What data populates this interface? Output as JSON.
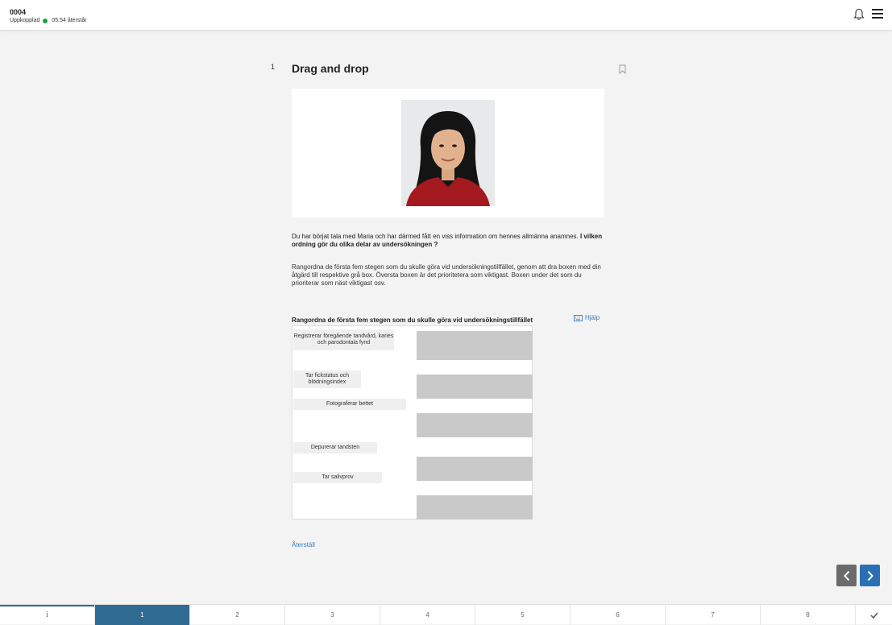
{
  "header": {
    "candidate_id": "0004",
    "connection_status": "Uppkopplad",
    "time_remaining": "05:54 återstår",
    "status_color": "#1aa34a",
    "icons": {
      "notifications": "bell-icon",
      "menu": "hamburger-menu-icon"
    }
  },
  "question": {
    "number": "1",
    "title": "Drag and drop",
    "bookmark_icon": "bookmark-icon",
    "image_subject": "portrait",
    "intro_text": "Du har börjat tala med Maria och har därmed fått en viss information om hennes allmänna anamnes.",
    "intro_bold": "I vilken ordning gör du olika delar av undersökningen ?",
    "instructions": "Rangordna de första fem stegen som du skulle göra vid undersökningstillfället, genom att dra boxen med din åtgärd till respektive grå box. Översta boxen är det prioritetera som viktigast. Boxen under det som du prioriterar som näst viktigast osv."
  },
  "dragdrop": {
    "title": "Rangordna de första fem stegen som du skulle göra vid undersökningstillfället",
    "help_label": "Hjälp",
    "help_icon": "keyboard-icon",
    "items": [
      "Registrerar föregående tandvård, karies och parodontala fynd",
      "Tar fickstatus och blödningsindex",
      "Fotograferar bettet",
      "Depurerar tandsten",
      "Tar salivprov"
    ],
    "slot_count": 5
  },
  "actions": {
    "reset_label": "Återställ"
  },
  "navigation": {
    "prev_icon": "chevron-left-icon",
    "next_icon": "chevron-right-icon",
    "accent": "#2a6fb3"
  },
  "footer": {
    "info_label": "i",
    "tabs": [
      "1",
      "2",
      "3",
      "4",
      "5",
      "6",
      "7",
      "8"
    ],
    "active_tab": "1",
    "finish_icon": "check-icon"
  }
}
